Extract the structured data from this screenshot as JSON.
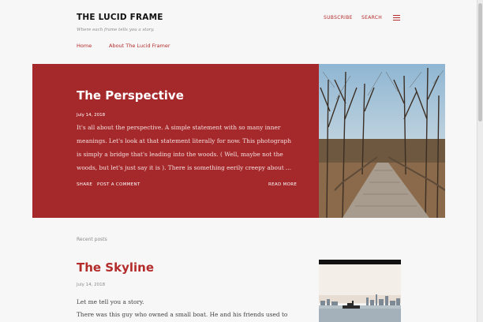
{
  "header": {
    "blog_title": "THE LUCID FRAME",
    "tagline": "Where each frame tells you a story.",
    "subscribe": "SUBSCRIBE",
    "search": "SEARCH"
  },
  "nav": {
    "home": "Home",
    "about": "About The Lucid Framer"
  },
  "featured": {
    "title": "The Perspective",
    "date": "July 14, 2018",
    "snippet": "It's all about the perspective. A simple statement with so many inner meanings. Let's look at that statement literally for now. This photograph is simply a bridge that's leading into the woods. ( Well, maybe not the woods, but let's just say it is ). There is something eerily creepy about",
    "ellipsis": "…",
    "share": "SHARE",
    "post_comment": "POST A COMMENT",
    "read_more": "READ MORE",
    "image": "boardwalk-through-bare-trees-photo"
  },
  "recent": {
    "label": "Recent posts",
    "post": {
      "title": "The Skyline",
      "date": "July 14, 2018",
      "line1": "Let me tell you a story.",
      "line2": "There was this guy who owned a small boat. He and his friends used to",
      "image": "city-skyline-over-water-photo"
    }
  },
  "colors": {
    "accent": "#b42b2b",
    "featured_bg": "#a5282b",
    "page_bg": "#f7f7f7"
  }
}
